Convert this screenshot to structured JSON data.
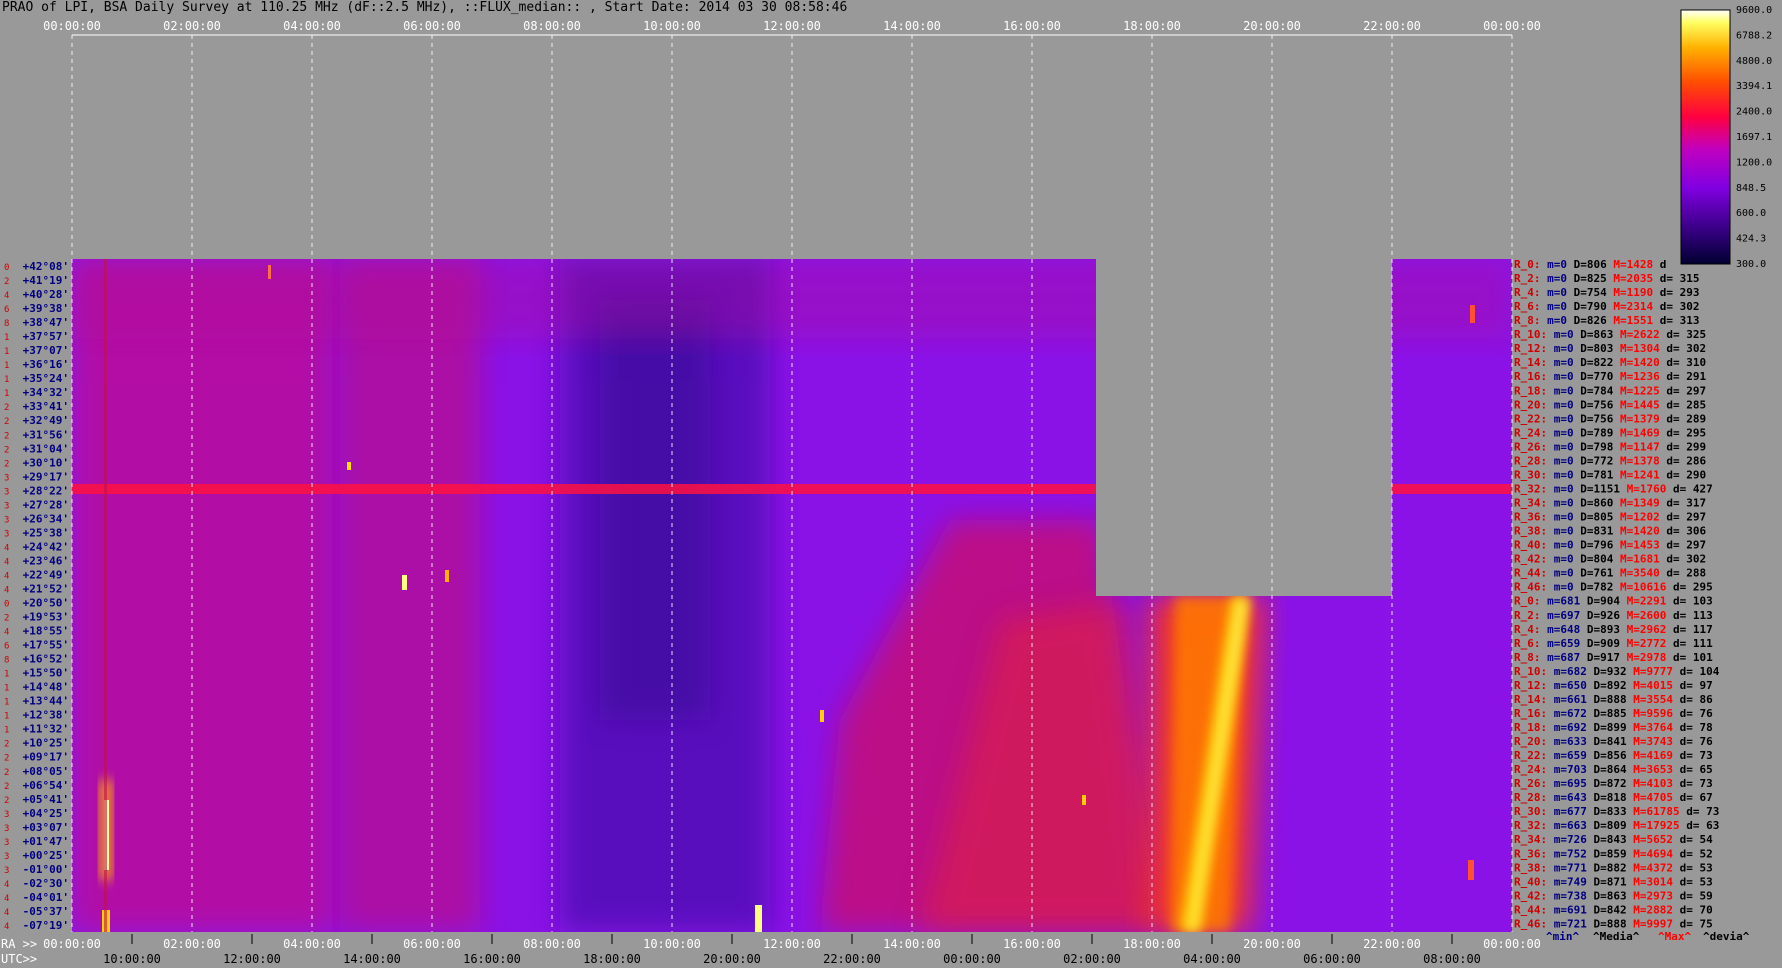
{
  "title": "PRAO of LPI, BSA Daily Survey at 110.25 MHz (dF::2.5 MHz), ::FLUX_median:: , Start Date: 2014 03 30 08:58:46",
  "colors": {
    "background": "#999999",
    "grid": "#ffffff",
    "dec_label": "#000080",
    "index_label": "#d00000"
  },
  "chart_data": {
    "type": "heatmap",
    "title": "PRAO of LPI, BSA Daily Survey at 110.25 MHz (dF::2.5 MHz), ::FLUX_median:: , Start Date: 2014 03 30 08:58:46",
    "top_axis_labels": [
      "00:00:00",
      "02:00:00",
      "04:00:00",
      "06:00:00",
      "08:00:00",
      "10:00:00",
      "12:00:00",
      "14:00:00",
      "16:00:00",
      "18:00:00",
      "20:00:00",
      "22:00:00",
      "00:00:00"
    ],
    "ra_prefix": "RA >>",
    "ra_axis_labels": [
      "00:00:00",
      "02:00:00",
      "04:00:00",
      "06:00:00",
      "08:00:00",
      "10:00:00",
      "12:00:00",
      "14:00:00",
      "16:00:00",
      "18:00:00",
      "20:00:00",
      "22:00:00",
      "00:00:00"
    ],
    "utc_prefix": "UTC>>",
    "utc_axis_labels": [
      "10:00:00",
      "12:00:00",
      "14:00:00",
      "16:00:00",
      "18:00:00",
      "20:00:00",
      "22:00:00",
      "00:00:00",
      "02:00:00",
      "04:00:00",
      "06:00:00",
      "08:00:00"
    ],
    "dec_labels": [
      "+42°08'",
      "+41°19'",
      "+40°28'",
      "+39°38'",
      "+38°47'",
      "+37°57'",
      "+37°07'",
      "+36°16'",
      "+35°24'",
      "+34°32'",
      "+33°41'",
      "+32°49'",
      "+31°56'",
      "+31°04'",
      "+30°10'",
      "+29°17'",
      "+28°22'",
      "+27°28'",
      "+26°34'",
      "+25°38'",
      "+24°42'",
      "+23°46'",
      "+22°49'",
      "+21°52'",
      "+20°50'",
      "+19°53'",
      "+18°55'",
      "+17°55'",
      "+16°52'",
      "+15°50'",
      "+14°48'",
      "+13°44'",
      "+12°38'",
      "+11°32'",
      "+10°25'",
      "+09°17'",
      "+08°05'",
      "+06°54'",
      "+05°41'",
      "+04°25'",
      "+03°07'",
      "+01°47'",
      "+00°25'",
      "-01°00'",
      "-02°30'",
      "-04°01'",
      "-05°37'",
      "-07°19'"
    ],
    "colorbar": {
      "ticks": [
        "9600.0",
        "6788.2",
        "4800.0",
        "3394.1",
        "2400.0",
        "1697.1",
        "1200.0",
        "848.5",
        "600.0",
        "424.3",
        "300.0"
      ],
      "min": 300.0,
      "max": 9600.0,
      "scale": "log"
    },
    "row_stats": [
      {
        "r": "R_0:",
        "m": "m=0",
        "D": "D=806",
        "M": "M=1428",
        "d": "d"
      },
      {
        "r": "R_2:",
        "m": "m=0",
        "D": "D=825",
        "M": "M=2035",
        "d": "d= 315"
      },
      {
        "r": "R_4:",
        "m": "m=0",
        "D": "D=754",
        "M": "M=1190",
        "d": "d= 293"
      },
      {
        "r": "R_6:",
        "m": "m=0",
        "D": "D=790",
        "M": "M=2314",
        "d": "d= 302"
      },
      {
        "r": "R_8:",
        "m": "m=0",
        "D": "D=826",
        "M": "M=1551",
        "d": "d= 313"
      },
      {
        "r": "R_10:",
        "m": "m=0",
        "D": "D=863",
        "M": "M=2622",
        "d": "d= 325"
      },
      {
        "r": "R_12:",
        "m": "m=0",
        "D": "D=803",
        "M": "M=1304",
        "d": "d= 302"
      },
      {
        "r": "R_14:",
        "m": "m=0",
        "D": "D=822",
        "M": "M=1420",
        "d": "d= 310"
      },
      {
        "r": "R_16:",
        "m": "m=0",
        "D": "D=770",
        "M": "M=1236",
        "d": "d= 291"
      },
      {
        "r": "R_18:",
        "m": "m=0",
        "D": "D=784",
        "M": "M=1225",
        "d": "d= 297"
      },
      {
        "r": "R_20:",
        "m": "m=0",
        "D": "D=756",
        "M": "M=1445",
        "d": "d= 285"
      },
      {
        "r": "R_22:",
        "m": "m=0",
        "D": "D=756",
        "M": "M=1379",
        "d": "d= 289"
      },
      {
        "r": "R_24:",
        "m": "m=0",
        "D": "D=789",
        "M": "M=1469",
        "d": "d= 295"
      },
      {
        "r": "R_26:",
        "m": "m=0",
        "D": "D=798",
        "M": "M=1147",
        "d": "d= 299"
      },
      {
        "r": "R_28:",
        "m": "m=0",
        "D": "D=772",
        "M": "M=1378",
        "d": "d= 286"
      },
      {
        "r": "R_30:",
        "m": "m=0",
        "D": "D=781",
        "M": "M=1241",
        "d": "d= 290"
      },
      {
        "r": "R_32:",
        "m": "m=0",
        "D": "D=1151",
        "M": "M=1760",
        "d": "d= 427"
      },
      {
        "r": "R_34:",
        "m": "m=0",
        "D": "D=860",
        "M": "M=1349",
        "d": "d= 317"
      },
      {
        "r": "R_36:",
        "m": "m=0",
        "D": "D=805",
        "M": "M=1202",
        "d": "d= 297"
      },
      {
        "r": "R_38:",
        "m": "m=0",
        "D": "D=831",
        "M": "M=1420",
        "d": "d= 306"
      },
      {
        "r": "R_40:",
        "m": "m=0",
        "D": "D=796",
        "M": "M=1453",
        "d": "d= 297"
      },
      {
        "r": "R_42:",
        "m": "m=0",
        "D": "D=804",
        "M": "M=1681",
        "d": "d= 302"
      },
      {
        "r": "R_44:",
        "m": "m=0",
        "D": "D=761",
        "M": "M=3540",
        "d": "d= 288"
      },
      {
        "r": "R_46:",
        "m": "m=0",
        "D": "D=782",
        "M": "M=10616",
        "d": "d= 295"
      },
      {
        "r": "R_0:",
        "m": "m=681",
        "D": "D=904",
        "M": "M=2291",
        "d": "d= 103"
      },
      {
        "r": "R_2:",
        "m": "m=697",
        "D": "D=926",
        "M": "M=2600",
        "d": "d= 113"
      },
      {
        "r": "R_4:",
        "m": "m=648",
        "D": "D=893",
        "M": "M=2962",
        "d": "d= 117"
      },
      {
        "r": "R_6:",
        "m": "m=659",
        "D": "D=909",
        "M": "M=2772",
        "d": "d= 111"
      },
      {
        "r": "R_8:",
        "m": "m=687",
        "D": "D=917",
        "M": "M=2978",
        "d": "d= 101"
      },
      {
        "r": "R_10:",
        "m": "m=682",
        "D": "D=932",
        "M": "M=9777",
        "d": "d= 104"
      },
      {
        "r": "R_12:",
        "m": "m=650",
        "D": "D=892",
        "M": "M=4015",
        "d": "d= 97"
      },
      {
        "r": "R_14:",
        "m": "m=661",
        "D": "D=888",
        "M": "M=3554",
        "d": "d= 86"
      },
      {
        "r": "R_16:",
        "m": "m=672",
        "D": "D=885",
        "M": "M=9596",
        "d": "d= 76"
      },
      {
        "r": "R_18:",
        "m": "m=692",
        "D": "D=899",
        "M": "M=3764",
        "d": "d= 78"
      },
      {
        "r": "R_20:",
        "m": "m=633",
        "D": "D=841",
        "M": "M=3743",
        "d": "d= 76"
      },
      {
        "r": "R_22:",
        "m": "m=659",
        "D": "D=856",
        "M": "M=4169",
        "d": "d= 73"
      },
      {
        "r": "R_24:",
        "m": "m=703",
        "D": "D=864",
        "M": "M=3653",
        "d": "d= 65"
      },
      {
        "r": "R_26:",
        "m": "m=695",
        "D": "D=872",
        "M": "M=4103",
        "d": "d= 73"
      },
      {
        "r": "R_28:",
        "m": "m=643",
        "D": "D=818",
        "M": "M=4705",
        "d": "d= 67"
      },
      {
        "r": "R_30:",
        "m": "m=677",
        "D": "D=833",
        "M": "M=61785",
        "d": "d= 73"
      },
      {
        "r": "R_32:",
        "m": "m=663",
        "D": "D=809",
        "M": "M=17925",
        "d": "d= 63"
      },
      {
        "r": "R_34:",
        "m": "m=726",
        "D": "D=843",
        "M": "M=5652",
        "d": "d= 54"
      },
      {
        "r": "R_36:",
        "m": "m=752",
        "D": "D=859",
        "M": "M=4694",
        "d": "d= 52"
      },
      {
        "r": "R_38:",
        "m": "m=771",
        "D": "D=882",
        "M": "M=4372",
        "d": "d= 53"
      },
      {
        "r": "R_40:",
        "m": "m=749",
        "D": "D=871",
        "M": "M=3014",
        "d": "d= 53"
      },
      {
        "r": "R_42:",
        "m": "m=738",
        "D": "D=863",
        "M": "M=2973",
        "d": "d= 59"
      },
      {
        "r": "R_44:",
        "m": "m=691",
        "D": "D=842",
        "M": "M=2882",
        "d": "d= 70"
      },
      {
        "r": "R_46:",
        "m": "m=721",
        "D": "D=888",
        "M": "M=9997",
        "d": "d= 75"
      }
    ],
    "legend_footer": [
      "^min^",
      "^Media^",
      "^Max^",
      "^devia^"
    ]
  }
}
